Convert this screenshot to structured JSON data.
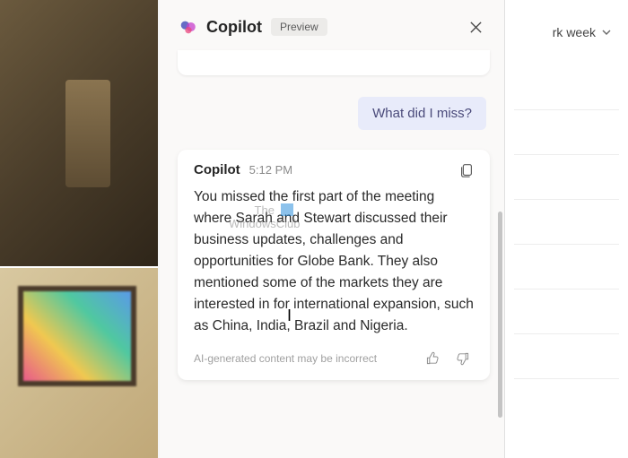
{
  "header": {
    "title": "Copilot",
    "badge": "Preview"
  },
  "conversation": {
    "user_message": "What did I miss?",
    "response": {
      "sender": "Copilot",
      "time": "5:12 PM",
      "body": "You missed the first part of the meeting where Sarah and Stewart discussed their business updates, challenges and opportunities for Globe Bank. They also mentioned some of the markets they are interested in for international expansion, such as China, India, Brazil and Nigeria.",
      "disclaimer": "AI-generated content may be incorrect"
    }
  },
  "calendar": {
    "view_label": "rk week"
  },
  "watermark": {
    "line1": "The",
    "line2": "WindowsClub"
  }
}
